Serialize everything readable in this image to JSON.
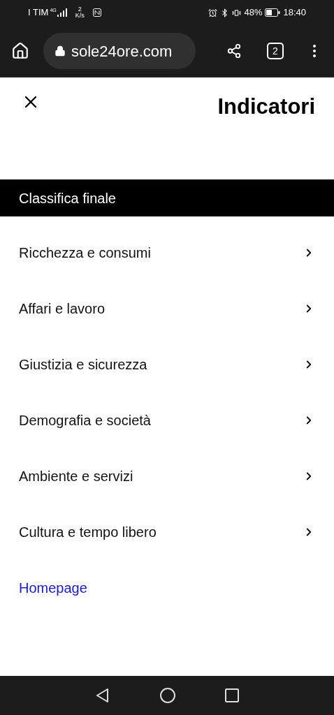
{
  "status_bar": {
    "carrier": "I TIM",
    "network": "4G",
    "speed": "2",
    "speed_unit": "K/s",
    "battery": "48%",
    "time": "18:40"
  },
  "browser": {
    "url": "sole24ore.com",
    "tab_count": "2"
  },
  "header": {
    "title": "Indicatori"
  },
  "menu": [
    {
      "label": "Classifica finale",
      "kind": "heading",
      "selected": true
    },
    {
      "label": "Ricchezza e consumi",
      "kind": "item",
      "selected": false
    },
    {
      "label": "Affari e lavoro",
      "kind": "item",
      "selected": false
    },
    {
      "label": "Giustizia e sicurezza",
      "kind": "item",
      "selected": false
    },
    {
      "label": "Demografia e società",
      "kind": "item",
      "selected": false
    },
    {
      "label": "Ambiente e servizi",
      "kind": "item",
      "selected": false
    },
    {
      "label": "Cultura e tempo libero",
      "kind": "item",
      "selected": false
    },
    {
      "label": "Homepage",
      "kind": "link",
      "selected": false
    }
  ]
}
